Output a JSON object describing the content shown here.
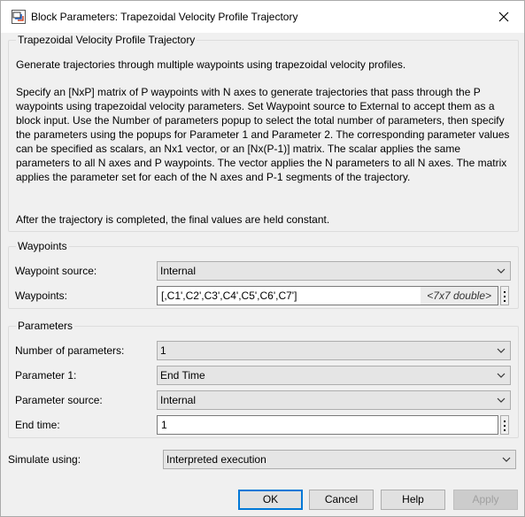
{
  "window": {
    "title": "Block Parameters: Trapezoidal Velocity Profile Trajectory",
    "icon": "simulink-block-icon",
    "close_icon": "close-icon"
  },
  "description": {
    "group_title": "Trapezoidal Velocity Profile Trajectory",
    "paragraphs": [
      "Generate trajectories through multiple waypoints using trapezoidal velocity profiles.",
      "Specify an [NxP] matrix of P waypoints with N axes to generate trajectories that pass through the P waypoints using trapezoidal velocity parameters. Set Waypoint source to External to accept them as a block input. Use the Number of parameters popup to select the total number of parameters, then specify the parameters using the popups for Parameter 1 and Parameter 2. The corresponding parameter values can be specified as scalars, an Nx1 vector, or an [Nx(P-1)] matrix. The scalar applies the same parameters to all N axes and P waypoints. The vector applies the N parameters to all N axes. The matrix applies the parameter set for each of the N axes and P-1 segments of the trajectory.",
      "After the trajectory is completed, the final values are held constant."
    ]
  },
  "waypoints": {
    "group_title": "Waypoints",
    "source_label": "Waypoint source:",
    "source_value": "Internal",
    "waypoints_label": "Waypoints:",
    "waypoints_value": "[,C1',C2',C3',C4',C5',C6',C7']",
    "waypoints_hint": "<7x7 double>"
  },
  "parameters": {
    "group_title": "Parameters",
    "num_label": "Number of parameters:",
    "num_value": "1",
    "param1_label": "Parameter 1:",
    "param1_value": "End Time",
    "source_label": "Parameter source:",
    "source_value": "Internal",
    "end_time_label": "End time:",
    "end_time_value": "1"
  },
  "simulate": {
    "label": "Simulate using:",
    "value": "Interpreted execution"
  },
  "buttons": {
    "ok": "OK",
    "cancel": "Cancel",
    "help": "Help",
    "apply": "Apply"
  }
}
